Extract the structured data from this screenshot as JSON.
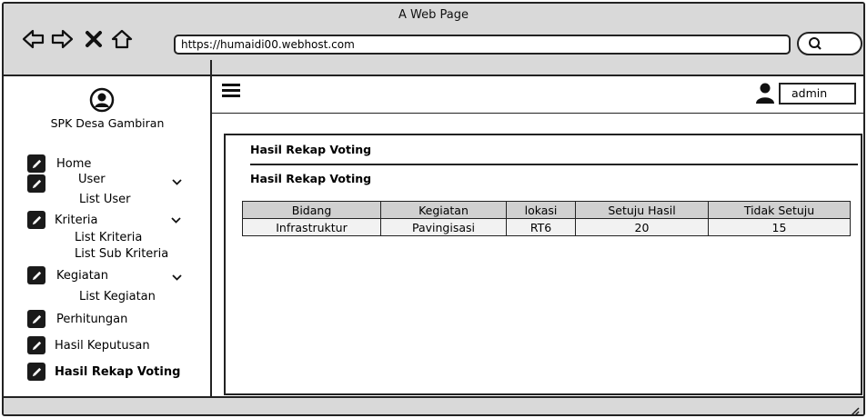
{
  "window": {
    "title": "A Web Page",
    "url": "https://humaidi00.webhost.com"
  },
  "browser_icons": [
    "back-arrow-icon",
    "forward-arrow-icon",
    "close-x-icon",
    "home-icon",
    "search-icon"
  ],
  "sidebar": {
    "brand": "SPK Desa Gambiran",
    "items": [
      {
        "label": "Home"
      },
      {
        "label": "User"
      },
      {
        "label": "List User"
      },
      {
        "label": "Kriteria"
      },
      {
        "label": "List Kriteria"
      },
      {
        "label": "List Sub Kriteria"
      },
      {
        "label": "Kegiatan"
      },
      {
        "label": "List Kegiatan"
      },
      {
        "label": "Perhitungan"
      },
      {
        "label": "Hasil Keputusan"
      },
      {
        "label": "Hasil Rekap Voting"
      }
    ]
  },
  "header": {
    "user": "admin"
  },
  "main": {
    "title": "Hasil Rekap Voting",
    "subtitle": "Hasil Rekap Voting",
    "table": {
      "headers": [
        "Bidang",
        "Kegiatan",
        "lokasi",
        "Setuju Hasil",
        "Tidak Setuju"
      ],
      "rows": [
        [
          "Infrastruktur",
          "Pavingisasi",
          "RT6",
          "20",
          "15"
        ]
      ]
    }
  }
}
